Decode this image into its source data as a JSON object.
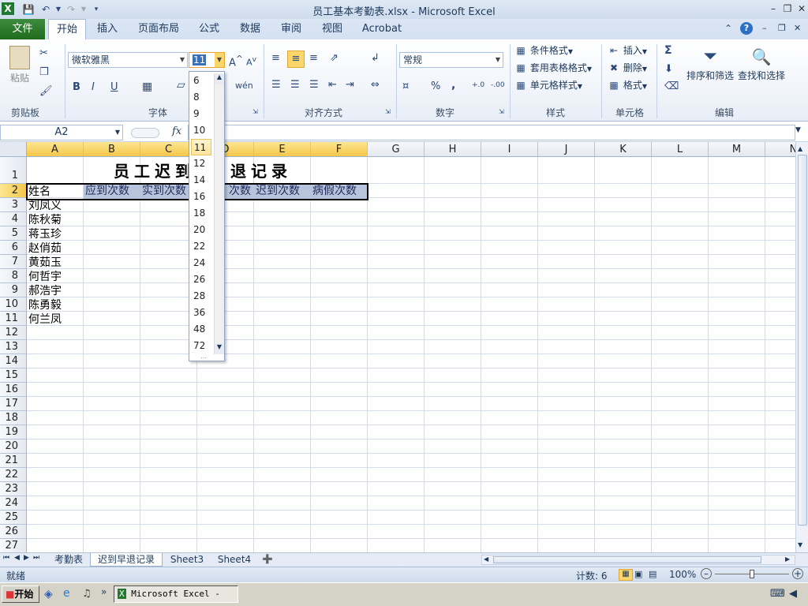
{
  "window": {
    "title": "员工基本考勤表.xlsx  -  Microsoft Excel"
  },
  "tabs": [
    {
      "label": "文件"
    },
    {
      "label": "开始"
    },
    {
      "label": "插入"
    },
    {
      "label": "页面布局"
    },
    {
      "label": "公式"
    },
    {
      "label": "数据"
    },
    {
      "label": "审阅"
    },
    {
      "label": "视图"
    },
    {
      "label": "Acrobat"
    }
  ],
  "ribbon": {
    "clipboard": {
      "paste": "粘贴",
      "group": "剪贴板"
    },
    "font": {
      "name": "微软雅黑",
      "size": "11",
      "group": "字体",
      "bold": "B",
      "italic": "I",
      "underline": "U"
    },
    "alignment": {
      "group": "对齐方式"
    },
    "number": {
      "format": "常规",
      "group": "数字",
      "percent": "%",
      "comma": ","
    },
    "styles": {
      "conditional": "条件格式",
      "table": "套用表格格式",
      "cell": "单元格样式",
      "group": "样式"
    },
    "cells": {
      "insert": "插入",
      "delete": "删除",
      "format": "格式",
      "group": "单元格"
    },
    "editing": {
      "sort": "排序和筛选",
      "find": "查找和选择",
      "group": "编辑",
      "sigma": "Σ"
    }
  },
  "formula_bar": {
    "name_box": "A2",
    "fx": "fx",
    "content": ""
  },
  "columns": [
    "A",
    "B",
    "C",
    "D",
    "E",
    "F",
    "G",
    "H",
    "I",
    "J",
    "K",
    "L",
    "M",
    "N"
  ],
  "rows": [
    "1",
    "2",
    "3",
    "4",
    "5",
    "6",
    "7",
    "8",
    "9",
    "10",
    "11",
    "12",
    "13",
    "14",
    "15",
    "16",
    "17",
    "18",
    "19",
    "20",
    "21",
    "22",
    "23",
    "24",
    "25",
    "26",
    "27"
  ],
  "sheet": {
    "title_visible": "员工迟到",
    "title_right": "退记录",
    "headers": [
      "姓名",
      "应到次数",
      "实到次数",
      "次数",
      "迟到次数",
      "病假次数"
    ],
    "names": [
      "刘凤义",
      "陈秋菊",
      "蒋玉珍",
      "赵俏茹",
      "黄茹玉",
      "何哲宇",
      "郝浩宇",
      "陈勇毅",
      "何兰凤"
    ]
  },
  "font_size_dropdown": {
    "options": [
      "6",
      "8",
      "9",
      "10",
      "11",
      "12",
      "14",
      "16",
      "18",
      "20",
      "22",
      "24",
      "26",
      "28",
      "36",
      "48",
      "72"
    ],
    "selected": "11"
  },
  "sheet_tabs": [
    {
      "label": "考勤表"
    },
    {
      "label": "迟到早退记录"
    },
    {
      "label": "Sheet3"
    },
    {
      "label": "Sheet4"
    }
  ],
  "status": {
    "ready": "就绪",
    "count": "计数: 6",
    "zoom": "100%"
  },
  "taskbar": {
    "start": "开始",
    "task": "Microsoft Excel - ..."
  }
}
